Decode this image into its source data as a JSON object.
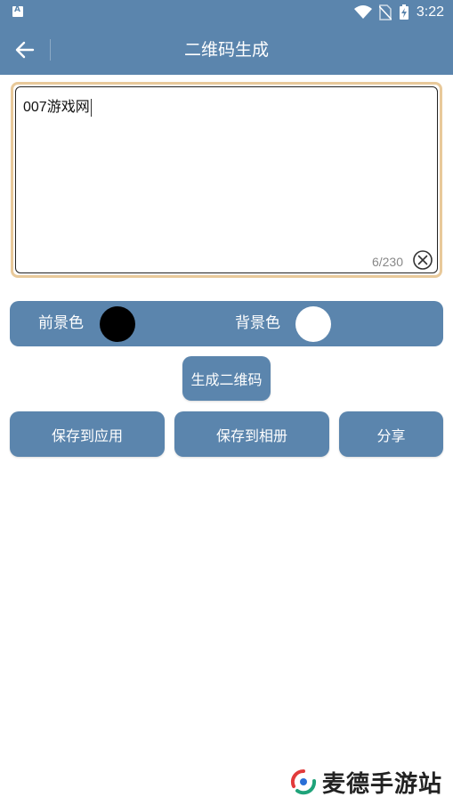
{
  "status_bar": {
    "time": "3:22"
  },
  "app_bar": {
    "title": "二维码生成"
  },
  "input": {
    "value": "007游戏网",
    "counter": "6/230"
  },
  "colors": {
    "foreground_label": "前景色",
    "foreground_color": "#000000",
    "background_label": "背景色",
    "background_color": "#ffffff"
  },
  "actions": {
    "generate_label": "生成二维码",
    "save_app_label": "保存到应用",
    "save_album_label": "保存到相册",
    "share_label": "分享"
  },
  "watermark": {
    "text": "麦德手游站"
  },
  "theme": {
    "primary": "#5b85ad",
    "input_border": "#e8c99a"
  }
}
